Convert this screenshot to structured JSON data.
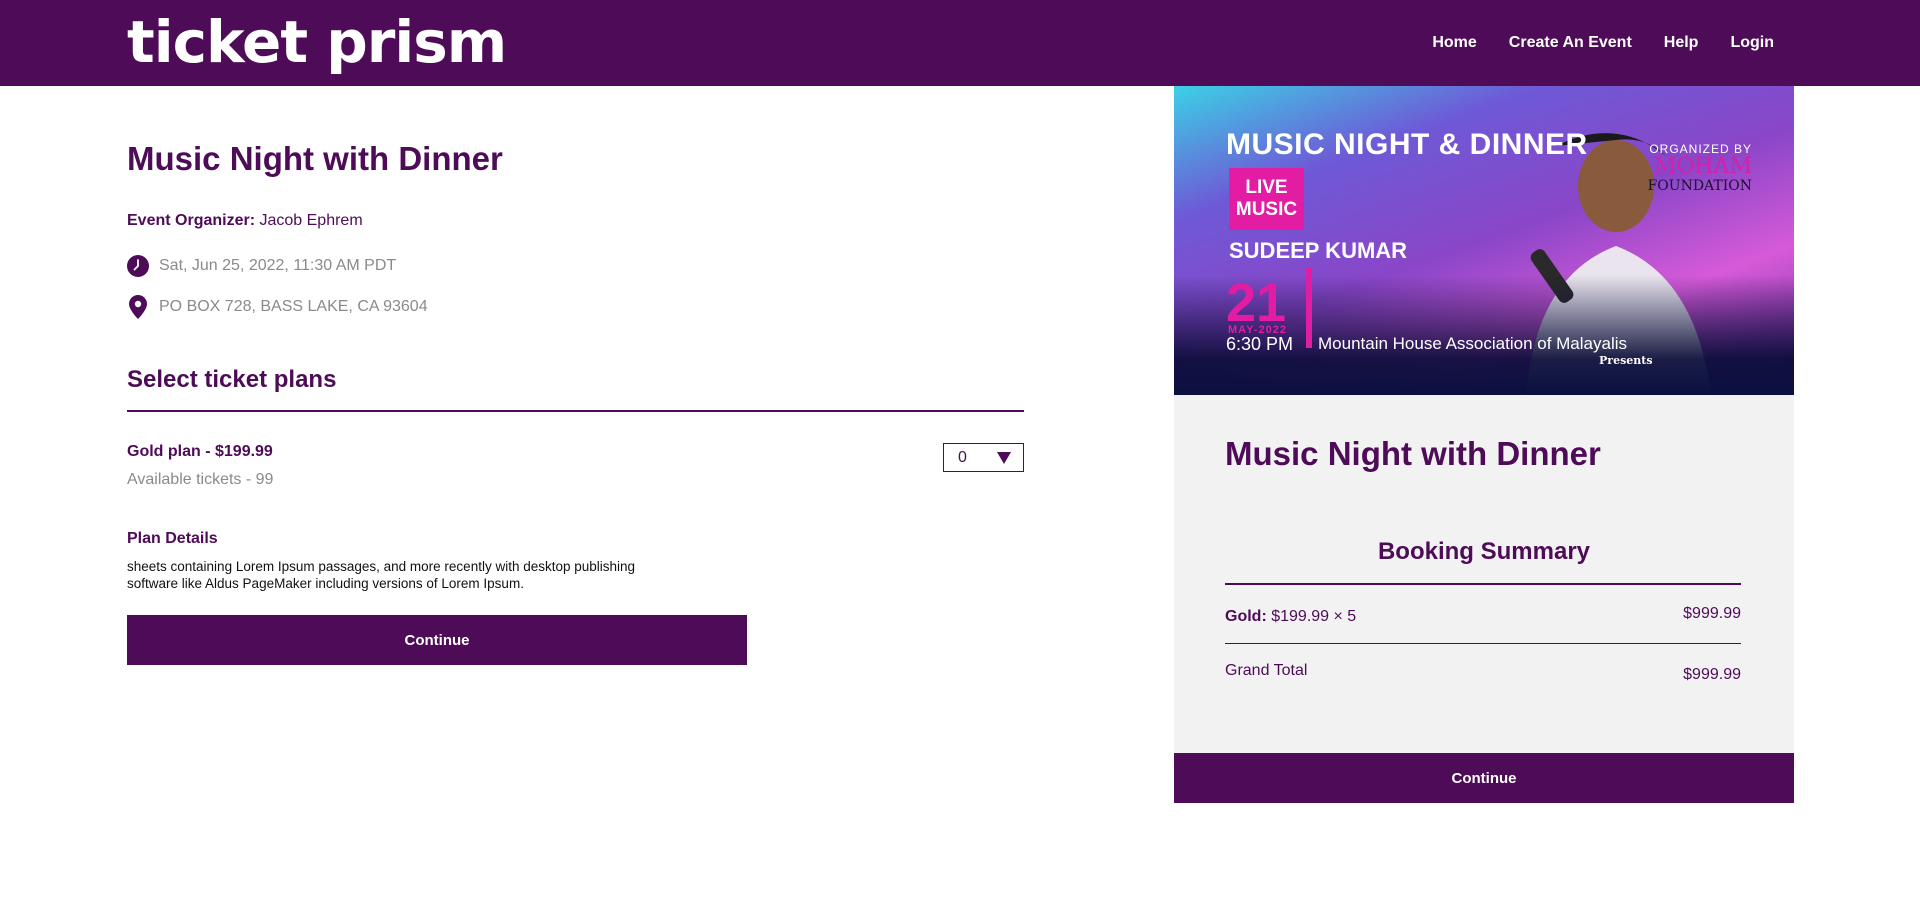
{
  "header": {
    "logo": "ticket prism",
    "nav": [
      "Home",
      "Create An Event",
      "Help",
      "Login"
    ]
  },
  "event": {
    "title": "Music Night with Dinner",
    "organizer_label": "Event Organizer:",
    "organizer_name": "Jacob Ephrem",
    "datetime": "Sat, Jun 25, 2022, 11:30 AM PDT",
    "location": "PO BOX 728, BASS LAKE, CA 93604",
    "icons": {
      "datetime": "clock-icon",
      "location": "map-pin-icon"
    }
  },
  "tickets": {
    "section_title": "Select ticket plans",
    "plan_name": "Gold plan - $199.99",
    "available": "Available tickets - 99",
    "quantity": "0",
    "details_title": "Plan Details",
    "details_text": "sheets containing Lorem Ipsum passages, and more recently with desktop publishing software like Aldus PageMaker including versions of Lorem Ipsum.",
    "continue_label": "Continue"
  },
  "poster": {
    "title": "MUSIC NIGHT & DINNER",
    "live": "LIVE MUSIC",
    "artist": "SUDEEP KUMAR",
    "day": "21",
    "month": "MAY-2022",
    "time": "6:30 PM",
    "association": "Mountain House Association of Malayalis",
    "presents": "Presents",
    "organized_by": "ORGANIZED BY",
    "org_name": "MOHAM",
    "org_sub": "FOUNDATION"
  },
  "summary": {
    "title": "Music Night with Dinner",
    "booking_title": "Booking Summary",
    "line_label": "Gold:",
    "line_detail": "$199.99 × 5",
    "line_amount": "$999.99",
    "grand_total_label": "Grand Total",
    "grand_total_amount": "$999.99",
    "continue_label": "Continue"
  },
  "colors": {
    "brand": "#4e0b57",
    "muted": "#8a8a8a",
    "panel": "#f2f2f2",
    "accent": "#e21ca3"
  }
}
